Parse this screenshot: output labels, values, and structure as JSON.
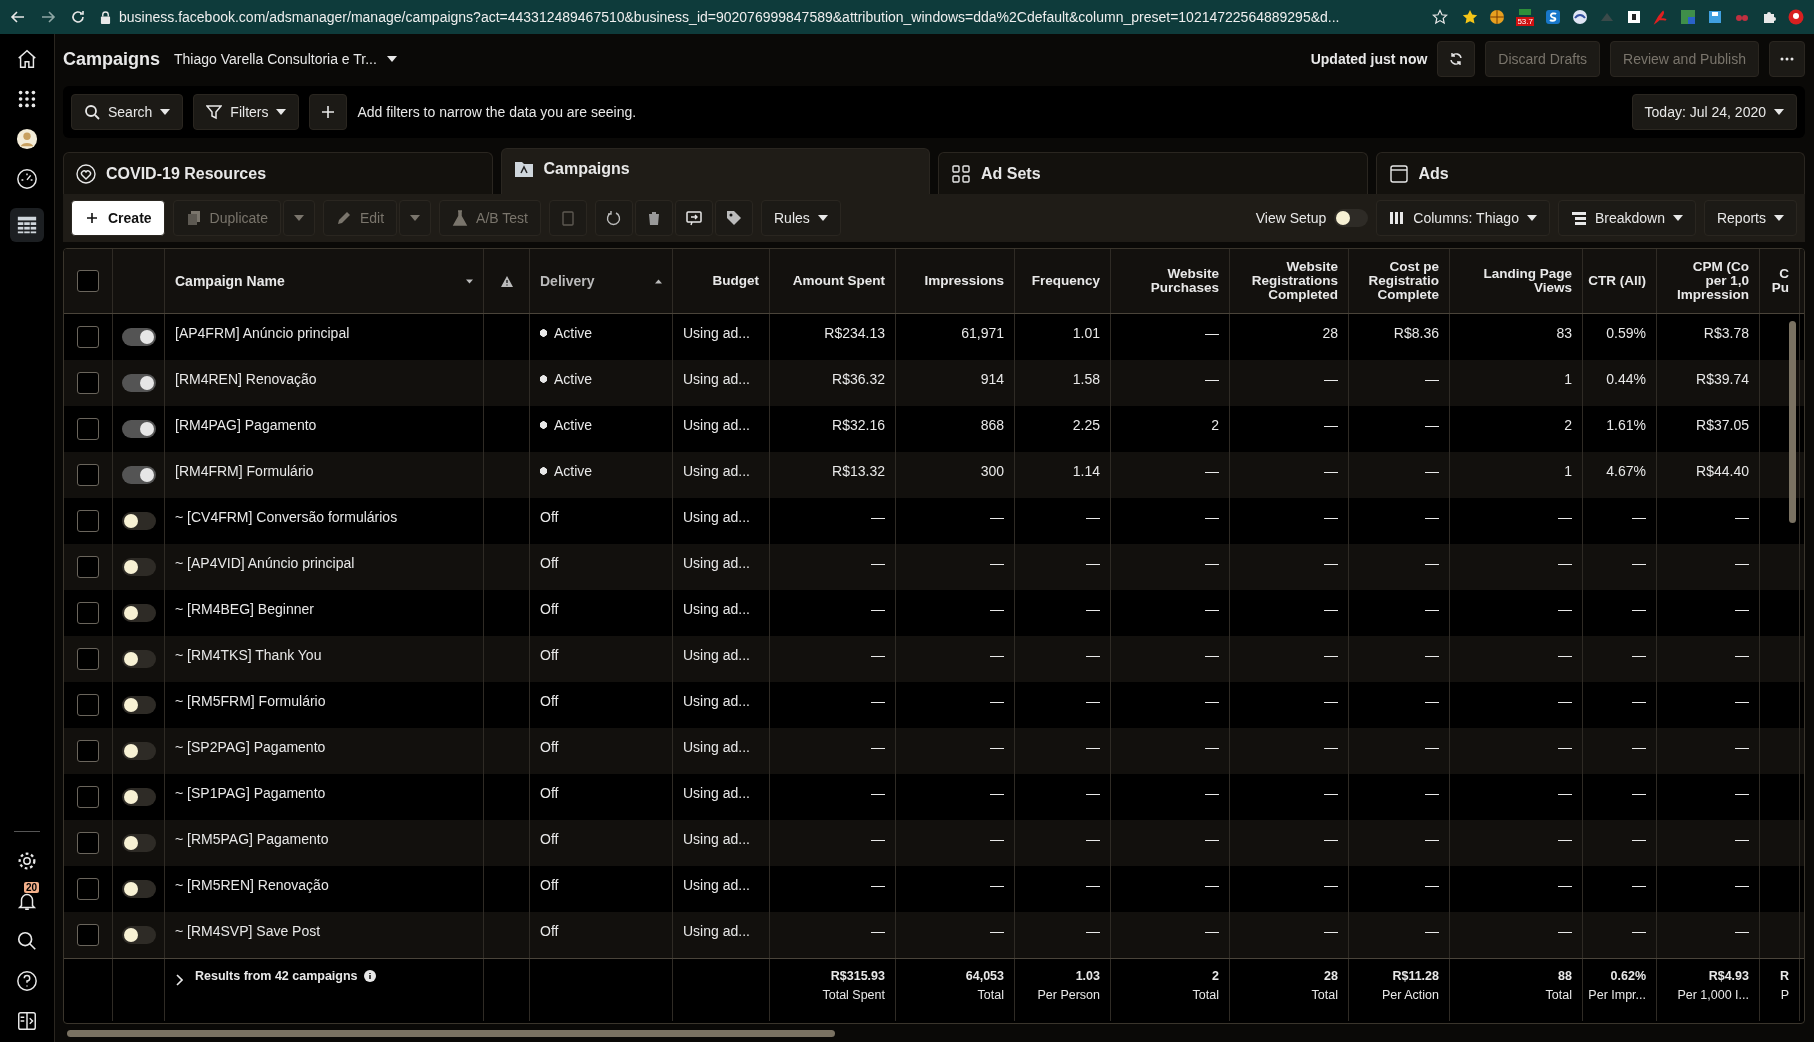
{
  "browser": {
    "url": "business.facebook.com/adsmanager/manage/campaigns?act=443312489467510&business_id=902076999847589&attribution_windows=dda%2Cdefault&column_preset=10214722564889295&d...",
    "extension_badge": "53.7"
  },
  "rail": {
    "notification_count": "20"
  },
  "header": {
    "title": "Campaigns",
    "account": "Thiago Varella Consultoria e Tr...",
    "updated": "Updated just now",
    "discard": {
      "label": "Discard Drafts",
      "disabled": true
    },
    "publish": {
      "label": "Review and Publish",
      "disabled": true
    }
  },
  "filter_bar": {
    "search": "Search",
    "filters": "Filters",
    "hint": "Add filters to narrow the data you are seeing.",
    "date": "Today: Jul 24, 2020"
  },
  "tabs": [
    {
      "label": "COVID-19 Resources",
      "selected": false
    },
    {
      "label": "Campaigns",
      "selected": true
    },
    {
      "label": "Ad Sets",
      "selected": false
    },
    {
      "label": "Ads",
      "selected": false
    }
  ],
  "toolbar": {
    "create": "Create",
    "duplicate": {
      "label": "Duplicate",
      "disabled": true
    },
    "edit": {
      "label": "Edit",
      "disabled": true
    },
    "ab_test": {
      "label": "A/B Test",
      "disabled": true
    },
    "rules": "Rules",
    "view_setup": {
      "label": "View Setup",
      "on": false
    },
    "columns": "Columns: Thiago",
    "breakdown": "Breakdown",
    "reports": "Reports"
  },
  "table": {
    "select_all_checked": false,
    "columns": [
      {
        "lines": [
          "Campaign Name"
        ]
      },
      {
        "lines": [
          "Delivery"
        ]
      },
      {
        "lines": [
          "Budget"
        ]
      },
      {
        "lines": [
          "Amount Spent"
        ]
      },
      {
        "lines": [
          "Impressions"
        ]
      },
      {
        "lines": [
          "Frequency"
        ]
      },
      {
        "lines": [
          "Website",
          "Purchases"
        ]
      },
      {
        "lines": [
          "Website",
          "Registrations",
          "Completed"
        ]
      },
      {
        "lines": [
          "Cost pe",
          "Registratio",
          "Complete"
        ]
      },
      {
        "lines": [
          "Landing Page",
          "Views"
        ]
      },
      {
        "lines": [
          "CTR (All)"
        ]
      },
      {
        "lines": [
          "CPM (Co",
          "per 1,0",
          "Impression"
        ]
      },
      {
        "lines": [
          "C",
          "Pu"
        ]
      }
    ],
    "rows": [
      {
        "checked": false,
        "on": true,
        "active": true,
        "cells": [
          "[AP4FRM] Anúncio principal",
          "Active",
          "Using ad...",
          "R$234.13",
          "61,971",
          "1.01",
          "—",
          "28",
          "R$8.36",
          "83",
          "0.59%",
          "R$3.78"
        ]
      },
      {
        "checked": false,
        "on": true,
        "active": true,
        "cells": [
          "[RM4REN] Renovação",
          "Active",
          "Using ad...",
          "R$36.32",
          "914",
          "1.58",
          "—",
          "—",
          "—",
          "1",
          "0.44%",
          "R$39.74"
        ]
      },
      {
        "checked": false,
        "on": true,
        "active": true,
        "cells": [
          "[RM4PAG] Pagamento",
          "Active",
          "Using ad...",
          "R$32.16",
          "868",
          "2.25",
          "2",
          "—",
          "—",
          "2",
          "1.61%",
          "R$37.05"
        ]
      },
      {
        "checked": false,
        "on": true,
        "active": true,
        "cells": [
          "[RM4FRM] Formulário",
          "Active",
          "Using ad...",
          "R$13.32",
          "300",
          "1.14",
          "—",
          "—",
          "—",
          "1",
          "4.67%",
          "R$44.40"
        ]
      },
      {
        "checked": false,
        "on": false,
        "active": false,
        "cells": [
          "~ [CV4FRM] Conversão formulários",
          "Off",
          "Using ad...",
          "—",
          "—",
          "—",
          "—",
          "—",
          "—",
          "—",
          "—",
          "—"
        ]
      },
      {
        "checked": false,
        "on": false,
        "active": false,
        "cells": [
          "~ [AP4VID] Anúncio principal",
          "Off",
          "Using ad...",
          "—",
          "—",
          "—",
          "—",
          "—",
          "—",
          "—",
          "—",
          "—"
        ]
      },
      {
        "checked": false,
        "on": false,
        "active": false,
        "cells": [
          "~ [RM4BEG] Beginner",
          "Off",
          "Using ad...",
          "—",
          "—",
          "—",
          "—",
          "—",
          "—",
          "—",
          "—",
          "—"
        ]
      },
      {
        "checked": false,
        "on": false,
        "active": false,
        "cells": [
          "~ [RM4TKS] Thank You",
          "Off",
          "Using ad...",
          "—",
          "—",
          "—",
          "—",
          "—",
          "—",
          "—",
          "—",
          "—"
        ]
      },
      {
        "checked": false,
        "on": false,
        "active": false,
        "cells": [
          "~ [RM5FRM] Formulário",
          "Off",
          "Using ad...",
          "—",
          "—",
          "—",
          "—",
          "—",
          "—",
          "—",
          "—",
          "—"
        ]
      },
      {
        "checked": false,
        "on": false,
        "active": false,
        "cells": [
          "~ [SP2PAG] Pagamento",
          "Off",
          "Using ad...",
          "—",
          "—",
          "—",
          "—",
          "—",
          "—",
          "—",
          "—",
          "—"
        ]
      },
      {
        "checked": false,
        "on": false,
        "active": false,
        "cells": [
          "~ [SP1PAG] Pagamento",
          "Off",
          "Using ad...",
          "—",
          "—",
          "—",
          "—",
          "—",
          "—",
          "—",
          "—",
          "—"
        ]
      },
      {
        "checked": false,
        "on": false,
        "active": false,
        "cells": [
          "~ [RM5PAG] Pagamento",
          "Off",
          "Using ad...",
          "—",
          "—",
          "—",
          "—",
          "—",
          "—",
          "—",
          "—",
          "—"
        ]
      },
      {
        "checked": false,
        "on": false,
        "active": false,
        "cells": [
          "~ [RM5REN] Renovação",
          "Off",
          "Using ad...",
          "—",
          "—",
          "—",
          "—",
          "—",
          "—",
          "—",
          "—",
          "—"
        ]
      },
      {
        "checked": false,
        "on": false,
        "active": false,
        "cells": [
          "~ [RM4SVP] Save Post",
          "Off",
          "Using ad...",
          "—",
          "—",
          "—",
          "—",
          "—",
          "—",
          "—",
          "—",
          "—"
        ]
      }
    ],
    "footer": {
      "label": "Results from 42 campaigns",
      "totals": [
        {
          "value": "R$315.93",
          "caption": "Total Spent"
        },
        {
          "value": "64,053",
          "caption": "Total"
        },
        {
          "value": "1.03",
          "caption": "Per Person"
        },
        {
          "value": "2",
          "caption": "Total"
        },
        {
          "value": "28",
          "caption": "Total"
        },
        {
          "value": "R$11.28",
          "caption": "Per Action"
        },
        {
          "value": "88",
          "caption": "Total"
        },
        {
          "value": "0.62%",
          "caption": "Per Impr..."
        },
        {
          "value": "R$4.93",
          "caption": "Per 1,000 I..."
        },
        {
          "value": "R",
          "caption": "P"
        }
      ]
    }
  }
}
